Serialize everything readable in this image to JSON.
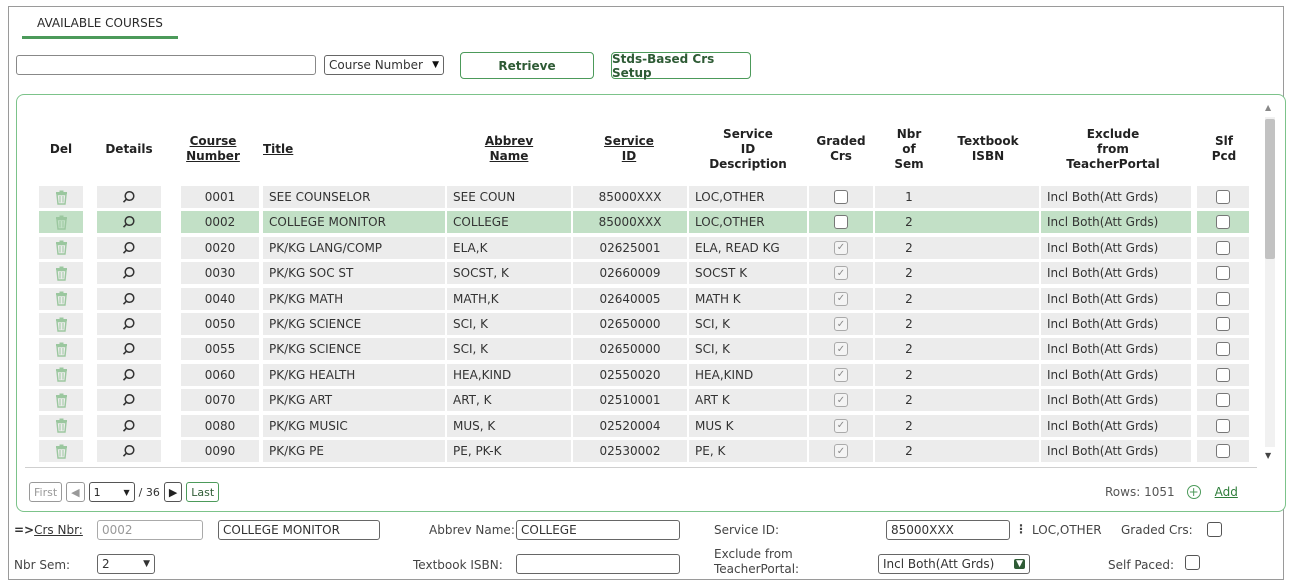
{
  "tab": {
    "title": "AVAILABLE COURSES"
  },
  "search": {
    "value": "",
    "select_value": "Course Number"
  },
  "buttons": {
    "retrieve": "Retrieve",
    "stds_setup": "Stds-Based Crs Setup"
  },
  "columns": {
    "del": "Del",
    "details": "Details",
    "course_number": "Course\nNumber",
    "title": "Title",
    "abbrev_name": "Abbrev\nName",
    "service_id": "Service\nID",
    "service_desc": "Service\nID\nDescription",
    "graded": "Graded\nCrs",
    "nbr_sem": "Nbr\nof\nSem",
    "textbook": "Textbook\nISBN",
    "exclude": "Exclude\nfrom\nTeacherPortal",
    "slf_pcd": "Slf\nPcd"
  },
  "rows": [
    {
      "num": "0001",
      "title": "SEE COUNSELOR",
      "abbrev": "SEE COUN",
      "service_id": "85000XXX",
      "service_desc": "LOC,OTHER",
      "graded": false,
      "sem": "1",
      "isbn": "",
      "exclude": "Incl Both(Att Grds)"
    },
    {
      "num": "0002",
      "title": "COLLEGE MONITOR",
      "abbrev": "COLLEGE",
      "service_id": "85000XXX",
      "service_desc": "LOC,OTHER",
      "graded": false,
      "sem": "2",
      "isbn": "",
      "exclude": "Incl Both(Att Grds)"
    },
    {
      "num": "0020",
      "title": "PK/KG LANG/COMP",
      "abbrev": "ELA,K",
      "service_id": "02625001",
      "service_desc": "ELA, READ KG",
      "graded": true,
      "sem": "2",
      "isbn": "",
      "exclude": "Incl Both(Att Grds)"
    },
    {
      "num": "0030",
      "title": "PK/KG SOC ST",
      "abbrev": "SOCST, K",
      "service_id": "02660009",
      "service_desc": "SOCST K",
      "graded": true,
      "sem": "2",
      "isbn": "",
      "exclude": "Incl Both(Att Grds)"
    },
    {
      "num": "0040",
      "title": "PK/KG MATH",
      "abbrev": "MATH,K",
      "service_id": "02640005",
      "service_desc": "MATH K",
      "graded": true,
      "sem": "2",
      "isbn": "",
      "exclude": "Incl Both(Att Grds)"
    },
    {
      "num": "0050",
      "title": "PK/KG SCIENCE",
      "abbrev": "SCI, K",
      "service_id": "02650000",
      "service_desc": "SCI, K",
      "graded": true,
      "sem": "2",
      "isbn": "",
      "exclude": "Incl Both(Att Grds)"
    },
    {
      "num": "0055",
      "title": "PK/KG SCIENCE",
      "abbrev": "SCI, K",
      "service_id": "02650000",
      "service_desc": "SCI, K",
      "graded": true,
      "sem": "2",
      "isbn": "",
      "exclude": "Incl Both(Att Grds)"
    },
    {
      "num": "0060",
      "title": "PK/KG HEALTH",
      "abbrev": "HEA,KIND",
      "service_id": "02550020",
      "service_desc": "HEA,KIND",
      "graded": true,
      "sem": "2",
      "isbn": "",
      "exclude": "Incl Both(Att Grds)"
    },
    {
      "num": "0070",
      "title": "PK/KG ART",
      "abbrev": "ART, K",
      "service_id": "02510001",
      "service_desc": "ART K",
      "graded": true,
      "sem": "2",
      "isbn": "",
      "exclude": "Incl Both(Att Grds)"
    },
    {
      "num": "0080",
      "title": "PK/KG MUSIC",
      "abbrev": "MUS, K",
      "service_id": "02520004",
      "service_desc": "MUS K",
      "graded": true,
      "sem": "2",
      "isbn": "",
      "exclude": "Incl Both(Att Grds)"
    },
    {
      "num": "0090",
      "title": "PK/KG PE",
      "abbrev": "PE, PK-K",
      "service_id": "02530002",
      "service_desc": "PE, K",
      "graded": true,
      "sem": "2",
      "isbn": "",
      "exclude": "Incl Both(Att Grds)"
    }
  ],
  "pager": {
    "first": "First",
    "page": "1",
    "total": "/ 36",
    "last": "Last",
    "rows": "Rows: 1051",
    "add": "Add"
  },
  "detail": {
    "crs_nbr_prefix": "=>",
    "crs_nbr_label": "Crs Nbr:",
    "crs_nbr": "0002",
    "title": "COLLEGE MONITOR",
    "abbrev_label": "Abbrev Name:",
    "abbrev": "COLLEGE",
    "service_label": "Service ID:",
    "service_id": "85000XXX",
    "service_desc": "LOC,OTHER",
    "graded_label": "Graded Crs:",
    "nbr_sem_label": "Nbr Sem:",
    "nbr_sem": "2",
    "isbn_label": "Textbook ISBN:",
    "isbn": "",
    "exclude_label": "Exclude from\nTeacherPortal:",
    "exclude": "Incl Both(Att Grds)",
    "self_paced_label": "Self Paced:"
  },
  "colors": {
    "accent": "#4c9a5a",
    "selected_row": "#c2e0c6",
    "row_bg": "#ececec"
  },
  "selected_row_index": 1
}
